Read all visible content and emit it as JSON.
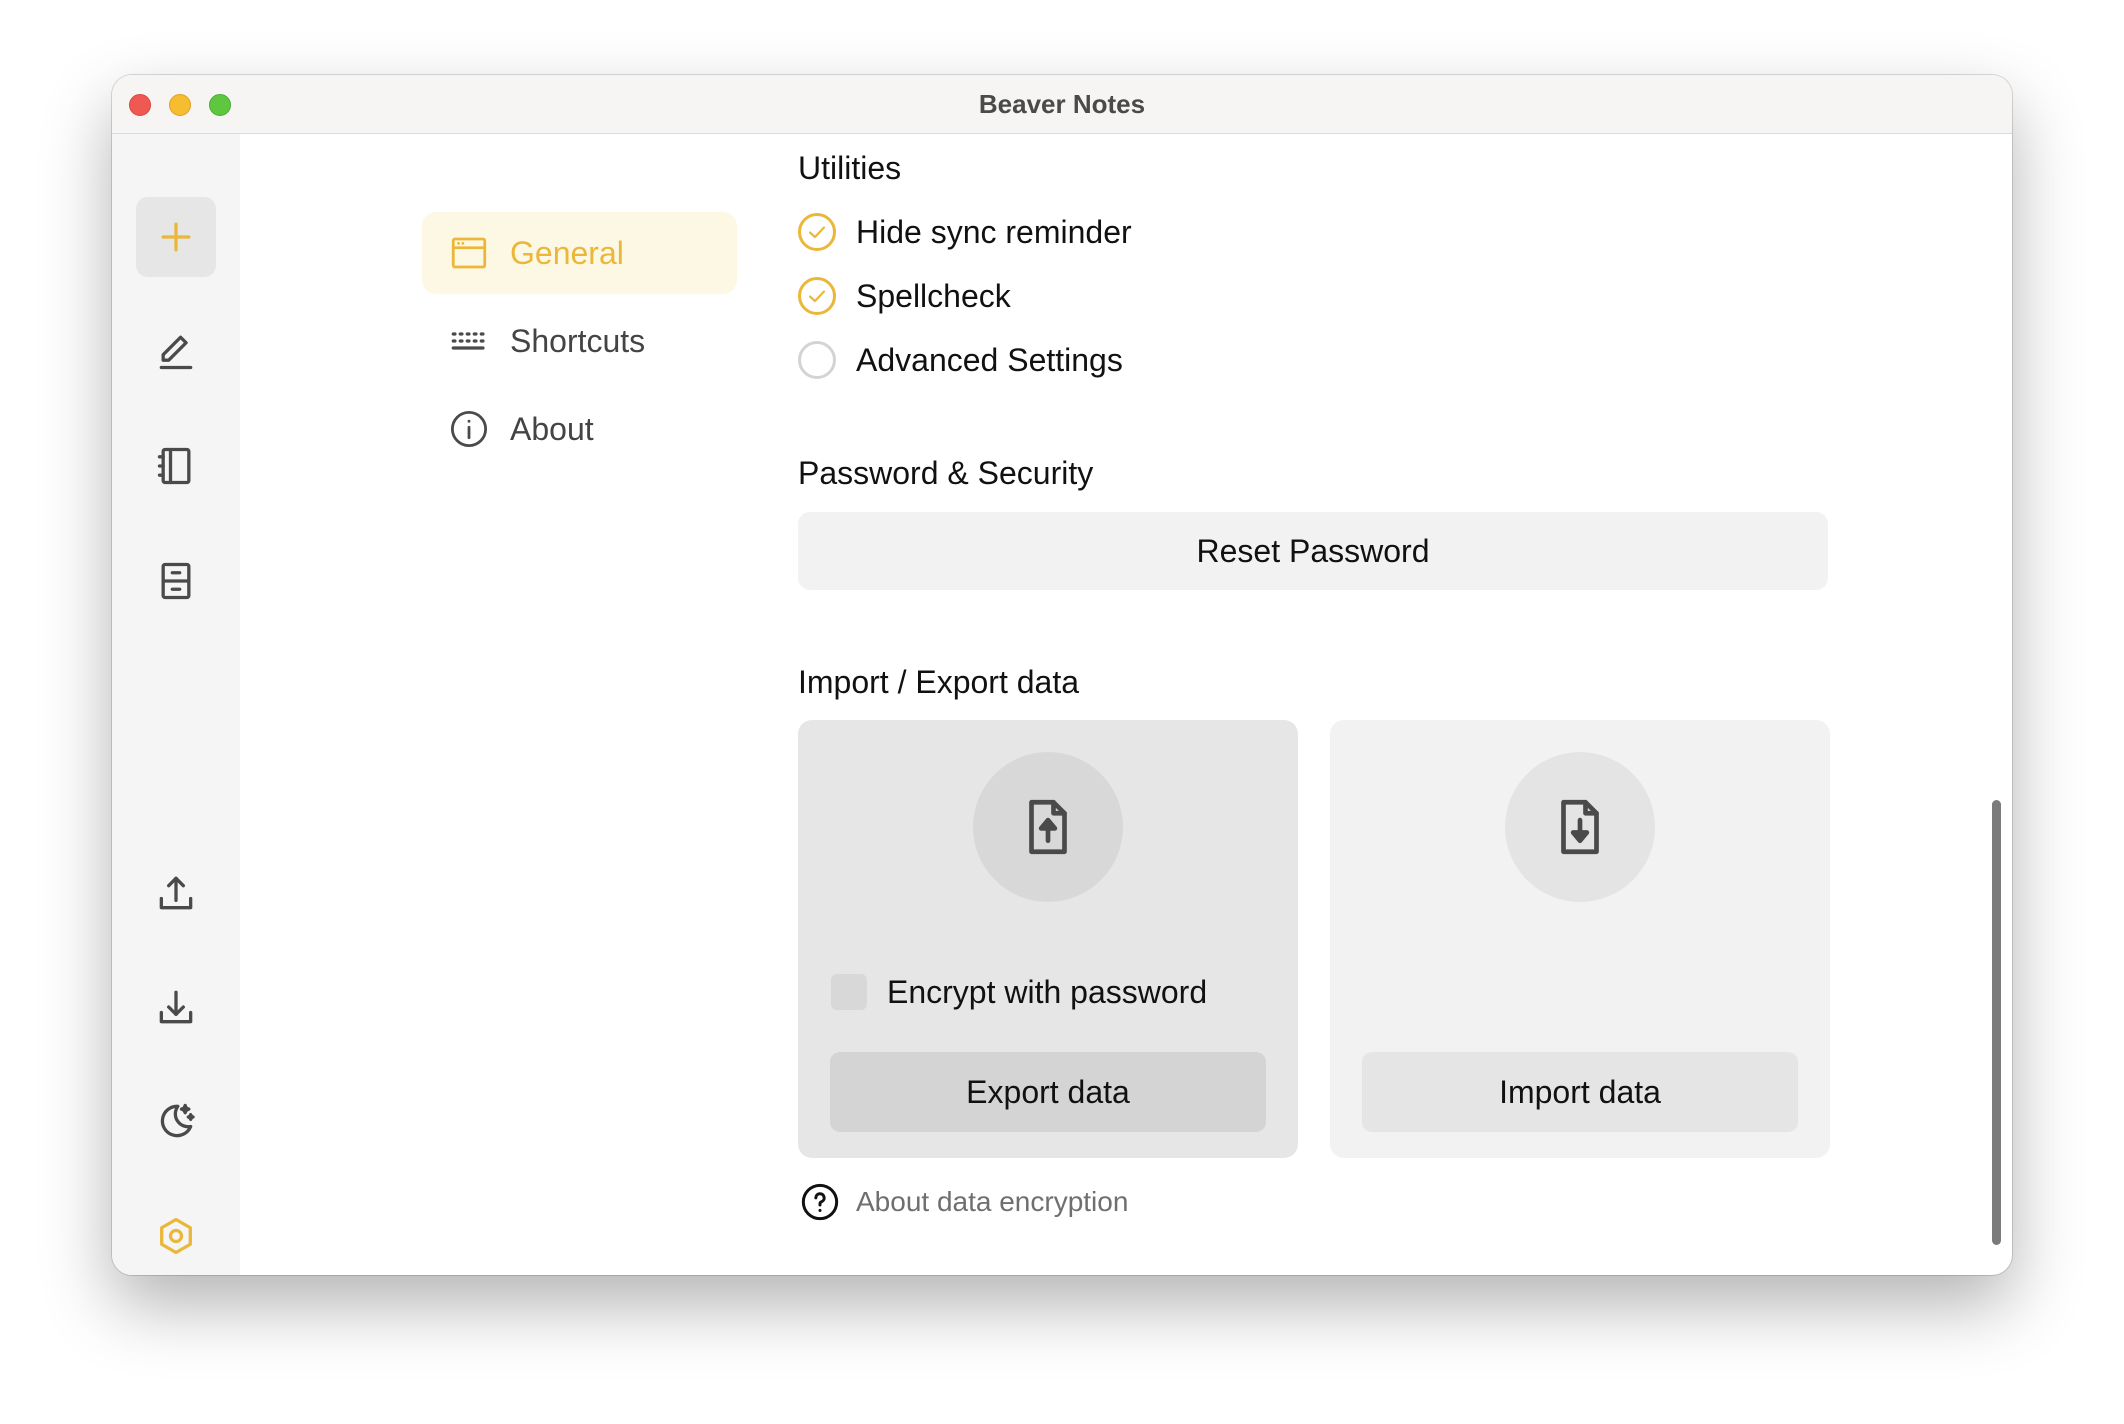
{
  "window": {
    "title": "Beaver Notes"
  },
  "colors": {
    "accent": "#ebb73a",
    "icon": "#4a4a4a"
  },
  "rail": {
    "items": [
      {
        "name": "add-note-button",
        "icon": "plus-icon"
      },
      {
        "name": "notes-button",
        "icon": "pencil-icon"
      },
      {
        "name": "folders-button",
        "icon": "notebook-icon"
      },
      {
        "name": "archive-button",
        "icon": "archive-icon"
      },
      {
        "name": "export-button",
        "icon": "upload-icon"
      },
      {
        "name": "import-button",
        "icon": "download-icon"
      },
      {
        "name": "theme-toggle-button",
        "icon": "moon-stars-icon"
      },
      {
        "name": "settings-button",
        "icon": "hexagon-settings-icon"
      }
    ]
  },
  "nav": {
    "items": [
      {
        "label": "General",
        "icon": "window-icon",
        "active": true
      },
      {
        "label": "Shortcuts",
        "icon": "keyboard-icon",
        "active": false
      },
      {
        "label": "About",
        "icon": "info-icon",
        "active": false
      }
    ]
  },
  "utilities": {
    "title": "Utilities",
    "options": [
      {
        "label": "Hide sync reminder",
        "checked": true
      },
      {
        "label": "Spellcheck",
        "checked": true
      },
      {
        "label": "Advanced Settings",
        "checked": false
      }
    ]
  },
  "security": {
    "title": "Password & Security",
    "reset_label": "Reset Password"
  },
  "data": {
    "title": "Import / Export data",
    "export": {
      "icon": "file-upload-icon",
      "encrypt_label": "Encrypt with password",
      "encrypt_checked": false,
      "button_label": "Export data"
    },
    "import": {
      "icon": "file-download-icon",
      "button_label": "Import data"
    },
    "about_label": "About data encryption"
  }
}
